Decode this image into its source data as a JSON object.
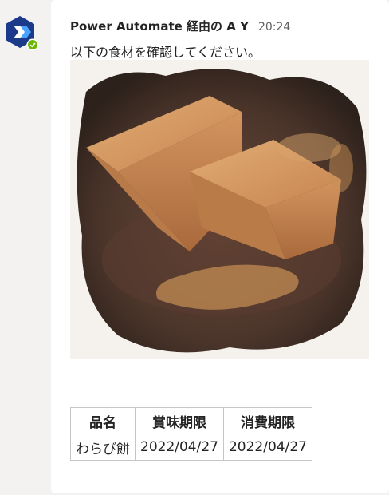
{
  "message": {
    "sender": "Power Automate 経由の A Y",
    "time": "20:24",
    "text": "以下の食材を確認してください。"
  },
  "photo": {
    "subject": "warabi-mochi-photo"
  },
  "table": {
    "headers": [
      "品名",
      "賞味期限",
      "消費期限"
    ],
    "rows": [
      [
        "わらび餅",
        "2022/04/27",
        "2022/04/27"
      ]
    ]
  },
  "colors": {
    "avatar_bg": "#1b3b8a",
    "status_ok": "#6bb700",
    "page_bg": "#f3f2f1"
  },
  "icons": {
    "avatar": "power-automate-icon",
    "status": "available-check-icon"
  }
}
